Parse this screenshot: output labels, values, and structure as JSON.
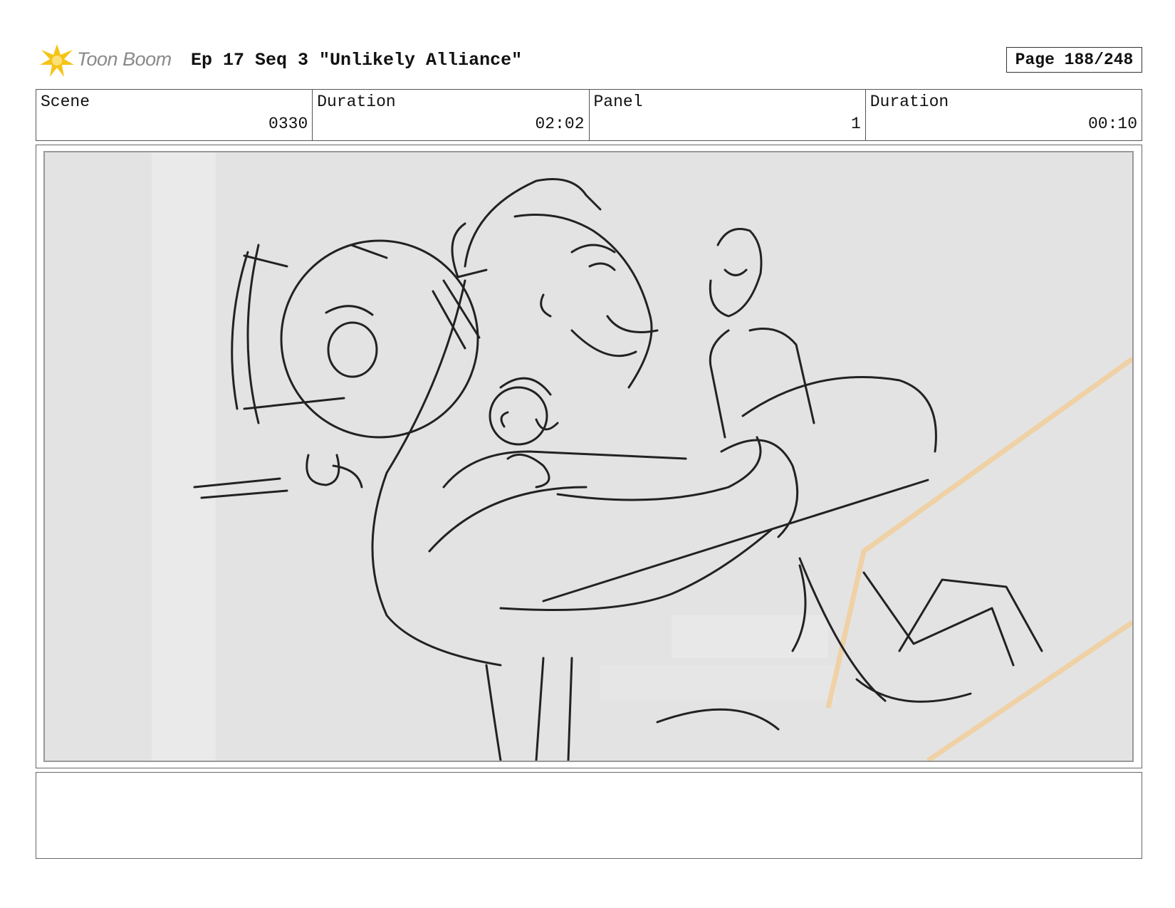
{
  "header": {
    "logo_text": "Toon Boom",
    "title": "Ep 17 Seq 3 \"Unlikely Alliance\"",
    "page": "Page 188/248"
  },
  "info": [
    {
      "label": "Scene",
      "value": "0330"
    },
    {
      "label": "Duration",
      "value": "02:02"
    },
    {
      "label": "Panel",
      "value": "1"
    },
    {
      "label": "Duration",
      "value": "00:10"
    }
  ],
  "panel": {
    "image_alt": "Storyboard sketch panel",
    "background_color": "#e3e3e3",
    "accent_streak_color": "#f4c98a"
  },
  "notes": {
    "text": ""
  },
  "colors": {
    "logo_star": "#f6c417",
    "logo_text": "#8a8a8a"
  }
}
